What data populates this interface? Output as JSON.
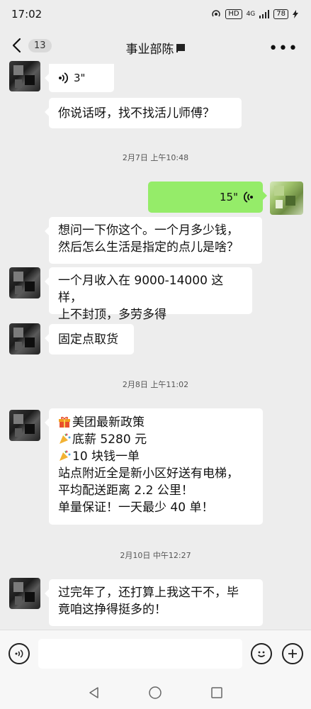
{
  "status_bar": {
    "time": "17:02",
    "network": "4G",
    "hd": "HD",
    "battery": "78"
  },
  "nav": {
    "unread_count": "13",
    "title": "事业部陈"
  },
  "messages": {
    "m1_voice_duration": "3\"",
    "m2_text": "你说话呀，找不找活儿师傅？",
    "ts1": "2月7日 上午10:48",
    "m3_voice_duration": "15\"",
    "m4_line1": "想问一下你这个。一个月多少钱，",
    "m4_line2": "然后怎么生活是指定的点儿是啥？",
    "m5_line1": "一个月收入在 9000-14000 这样，",
    "m5_line2": "上不封顶，多劳多得",
    "m6_text": "固定点取货",
    "ts2": "2月8日 上午11:02",
    "m7_line1": "美团最新政策",
    "m7_line2": "底薪 5280 元",
    "m7_line3": "10 块钱一单",
    "m7_line4": "站点附近全是新小区好送有电梯，",
    "m7_line5": "平均配送距离 2.2 公里！",
    "m7_line6": "单量保证！一天最少 40 单！",
    "ts3": "2月10日 中午12:27",
    "m8_line1": "过完年了，还打算上我这干不，毕",
    "m8_line2": "竟咱这挣得挺多的！"
  },
  "input": {
    "placeholder": ""
  },
  "icons": [
    "back-icon",
    "more-icon",
    "voice-wave-icon",
    "gift-icon",
    "party-popper-icon",
    "voice-input-icon",
    "emoji-icon",
    "plus-icon",
    "nav-back-icon",
    "nav-home-icon",
    "nav-recents-icon"
  ],
  "colors": {
    "background": "#ededed",
    "self_bubble": "#95ec69",
    "other_bubble": "#ffffff"
  }
}
